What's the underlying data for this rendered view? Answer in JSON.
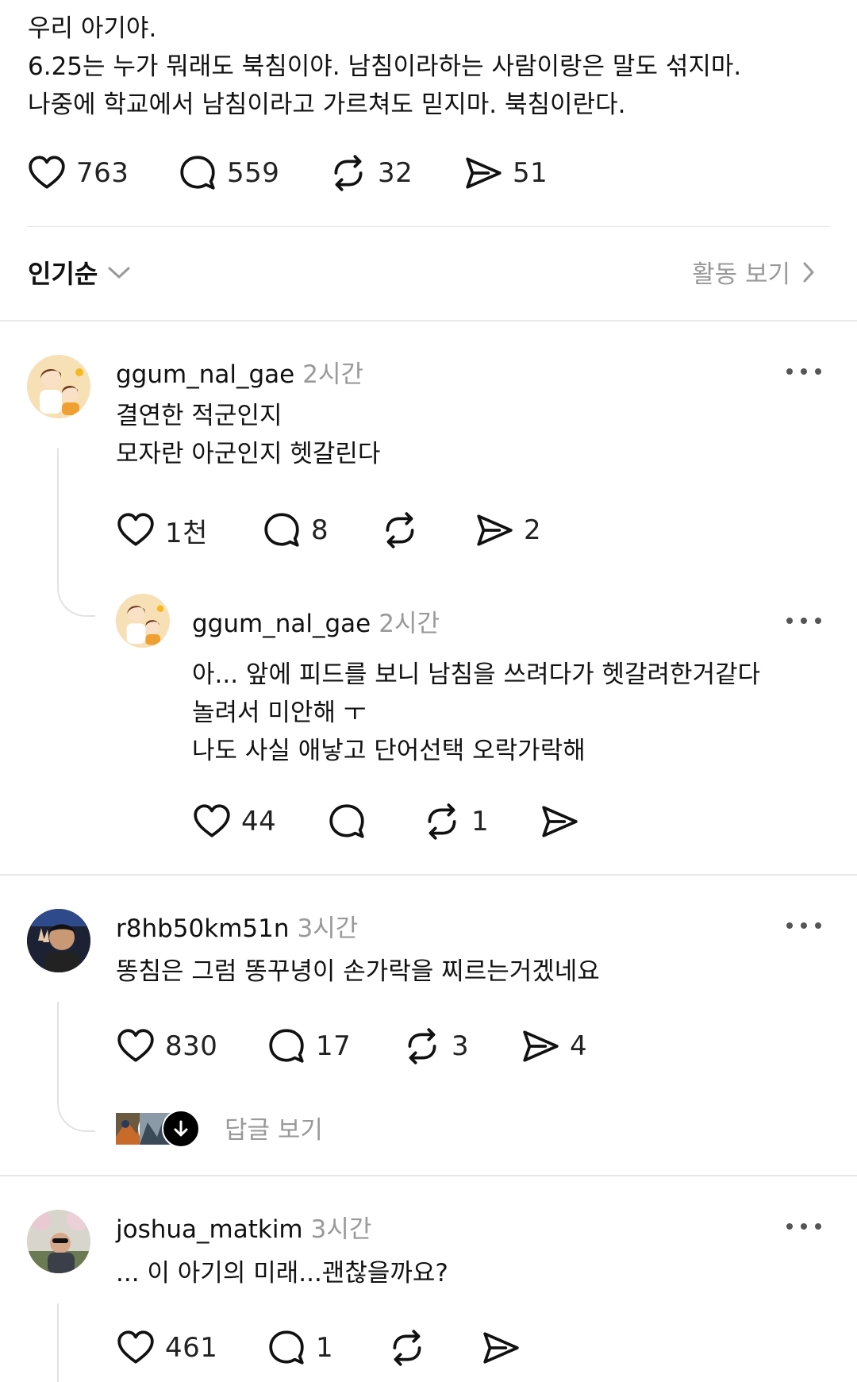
{
  "post": {
    "lines": [
      "우리 아기야.",
      "6.25는 누가 뭐래도 북침이야. 남침이라하는 사람이랑은 말도 섞지마.",
      "나중에 학교에서 남침이라고 가르쳐도 믿지마. 북침이란다."
    ],
    "likes": "763",
    "comments": "559",
    "reposts": "32",
    "shares": "51"
  },
  "sort": {
    "label": "인기순",
    "activity_label": "활동 보기"
  },
  "comments": [
    {
      "username": "ggum_nal_gae",
      "time": "2시간",
      "lines": [
        "결연한 적군인지",
        "모자란 아군인지 헷갈린다"
      ],
      "likes": "1천",
      "replies": "8",
      "reposts": "",
      "shares": "2",
      "reply": {
        "username": "ggum_nal_gae",
        "time": "2시간",
        "lines": [
          "아... 앞에 피드를 보니 남침을 쓰려다가 헷갈려한거같다",
          "놀려서 미안해 ㅜ",
          "나도 사실 애낳고 단어선택 오락가락해"
        ],
        "likes": "44",
        "replies": "",
        "reposts": "1",
        "shares": ""
      }
    },
    {
      "username": "r8hb50km51n",
      "time": "3시간",
      "lines": [
        "똥침은 그럼 똥꾸녕이 손가락을 찌르는거겠네요"
      ],
      "likes": "830",
      "replies": "17",
      "reposts": "3",
      "shares": "4",
      "see_replies_label": "답글 보기"
    },
    {
      "username": "joshua_matkim",
      "time": "3시간",
      "lines": [
        "... 이 아기의 미래...괜찮을까요?"
      ],
      "likes": "461",
      "replies": "1",
      "reposts": "",
      "shares": ""
    }
  ],
  "icons": {
    "like": "heart-icon",
    "reply": "speech-bubble-icon",
    "repost": "repost-arrows-icon",
    "share": "paper-plane-icon",
    "more": "more-dots-icon",
    "sort": "chevron-down-icon",
    "activity": "chevron-right-icon",
    "expand": "arrow-down-icon"
  },
  "colors": {
    "text": "#111111",
    "muted": "#999999",
    "divider": "#e4e4e4"
  }
}
